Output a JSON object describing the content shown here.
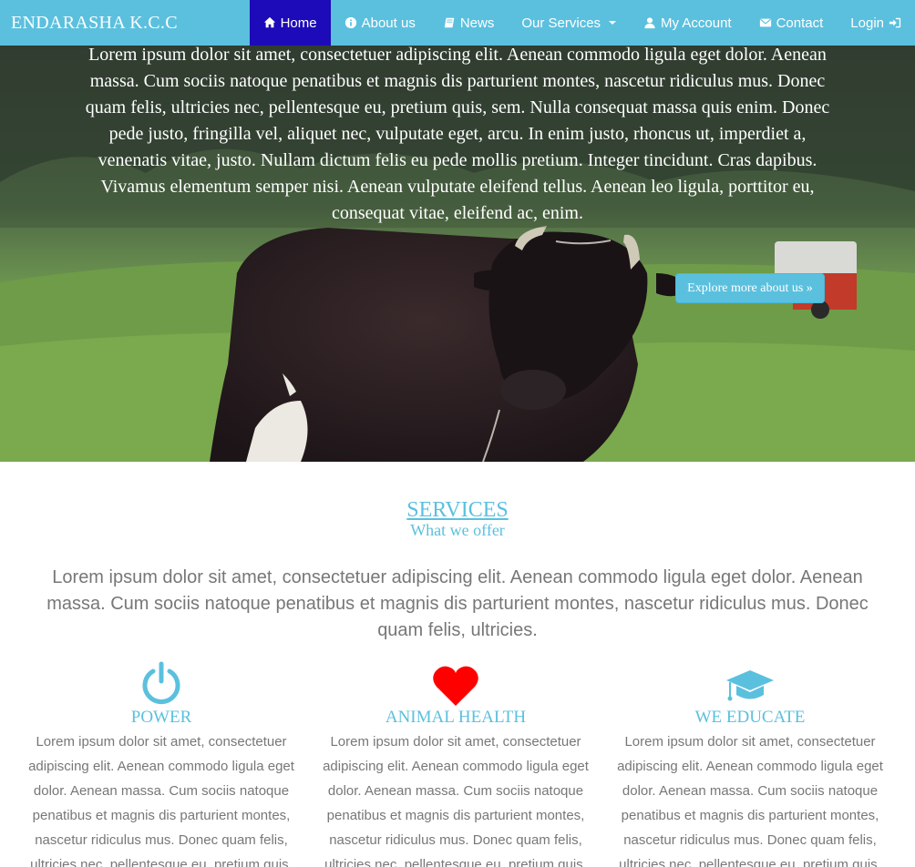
{
  "navbar": {
    "brand": "ENDARASHA K.C.C",
    "items": [
      {
        "label": "Home",
        "icon": "home-icon",
        "active": true
      },
      {
        "label": "About us",
        "icon": "info-icon"
      },
      {
        "label": "News",
        "icon": "book-icon"
      },
      {
        "label": "Our Services",
        "icon": "",
        "dropdown": true
      },
      {
        "label": "My Account",
        "icon": "user-icon"
      },
      {
        "label": "Contact",
        "icon": "envelope-icon"
      },
      {
        "label": "Login",
        "icon": "sign-in-icon"
      }
    ]
  },
  "hero": {
    "text": "Lorem ipsum dolor sit amet, consectetuer adipiscing elit. Aenean commodo ligula eget dolor. Aenean massa. Cum sociis natoque penatibus et magnis dis parturient montes, nascetur ridiculus mus. Donec quam felis, ultricies nec, pellentesque eu, pretium quis, sem. Nulla consequat massa quis enim. Donec pede justo, fringilla vel, aliquet nec, vulputate eget, arcu. In enim justo, rhoncus ut, imperdiet a, venenatis vitae, justo. Nullam dictum felis eu pede mollis pretium. Integer tincidunt. Cras dapibus. Vivamus elementum semper nisi. Aenean vulputate eleifend tellus. Aenean leo ligula, porttitor eu, consequat vitae, eleifend ac, enim.",
    "button": "Explore more about us »"
  },
  "services": {
    "title": "SERVICES",
    "subtitle": "What we offer",
    "intro": "Lorem ipsum dolor sit amet, consectetuer adipiscing elit. Aenean commodo ligula eget dolor. Aenean massa. Cum sociis natoque penatibus et magnis dis parturient montes, nascetur ridiculus mus. Donec quam felis, ultricies.",
    "columns": [
      {
        "title": "POWER",
        "icon": "power-icon",
        "text": "Lorem ipsum dolor sit amet, consectetuer adipiscing elit. Aenean commodo ligula eget dolor. Aenean massa. Cum sociis natoque penatibus et magnis dis parturient montes, nascetur ridiculus mus. Donec quam felis, ultricies nec, pellentesque eu, pretium quis,"
      },
      {
        "title": "ANIMAL HEALTH",
        "icon": "heart-icon",
        "text": "Lorem ipsum dolor sit amet, consectetuer adipiscing elit. Aenean commodo ligula eget dolor. Aenean massa. Cum sociis natoque penatibus et magnis dis parturient montes, nascetur ridiculus mus. Donec quam felis, ultricies nec, pellentesque eu, pretium quis,"
      },
      {
        "title": "WE EDUCATE",
        "icon": "graduation-cap-icon",
        "text": "Lorem ipsum dolor sit amet, consectetuer adipiscing elit. Aenean commodo ligula eget dolor. Aenean massa. Cum sociis natoque penatibus et magnis dis parturient montes, nascetur ridiculus mus. Donec quam felis, ultricies nec, pellentesque eu, pretium quis,"
      }
    ]
  },
  "colors": {
    "accent": "#5bc0de",
    "nav_active": "#1d0ab8",
    "heart": "#ff0000",
    "body_text": "#777777"
  }
}
